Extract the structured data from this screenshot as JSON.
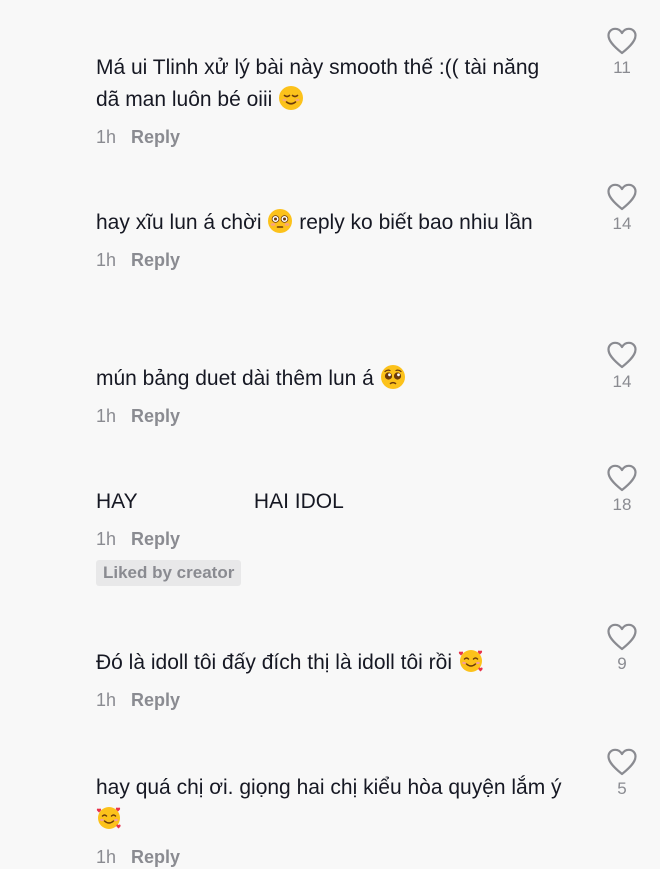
{
  "comments": [
    {
      "text_before": "Má ui Tlinh xử lý bài này smooth thế :(( tài năng dã man luôn bé oiii ",
      "emoji": "relieved-face",
      "text_after": "",
      "time": "1h",
      "reply_label": "Reply",
      "likes": "11"
    },
    {
      "text_before": "hay xĩu lun á chời ",
      "emoji": "flushed-face",
      "text_after": " reply ko biết bao nhiu lần",
      "time": "1h",
      "reply_label": "Reply",
      "likes": "14"
    },
    {
      "text_before": "mún bảng duet dài thêm lun á ",
      "emoji": "pleading-face",
      "text_after": "",
      "time": "1h",
      "reply_label": "Reply",
      "likes": "14"
    },
    {
      "text_before": "HAY                    HAI IDOL",
      "emoji": "",
      "text_after": "",
      "time": "1h",
      "reply_label": "Reply",
      "badge": "Liked by creator",
      "likes": "18"
    },
    {
      "text_before": "Đó là idoll tôi đấy đích thị là idoll tôi rồi ",
      "emoji": "smiling-face-with-hearts",
      "text_after": "",
      "time": "1h",
      "reply_label": "Reply",
      "likes": "9"
    },
    {
      "text_before": "hay quá chị ơi. giọng hai chị kiểu hòa quyện lắm ý",
      "emoji": "smiling-face-with-hearts",
      "text_after": "",
      "time": "1h",
      "reply_label": "Reply",
      "likes": "5"
    }
  ],
  "colors": {
    "background": "#f8f8f8",
    "text": "#161823",
    "muted": "#8a8b91",
    "badge_bg": "#e8e8e9"
  }
}
